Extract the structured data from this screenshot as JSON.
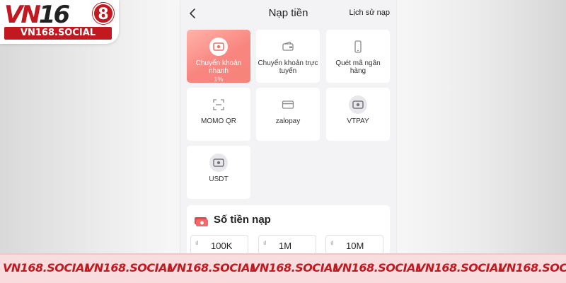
{
  "logo": {
    "main_red": "VN",
    "main_dark": "16",
    "circle": "8",
    "sub": "VN168.SOCIAL"
  },
  "header": {
    "back_icon": "chevron-left-icon",
    "title": "Nạp tiền",
    "history_label": "Lịch sử nạp"
  },
  "methods": [
    {
      "label": "Chuyển khoản nhanh",
      "sub": "1%",
      "icon": "money-transfer-icon",
      "active": true
    },
    {
      "label": "Chuyển khoản trực tuyến",
      "icon": "wallet-icon",
      "active": false
    },
    {
      "label": "Quét mã ngân hàng",
      "icon": "phone-icon",
      "active": false
    },
    {
      "label": "MOMO QR",
      "icon": "qr-scan-icon",
      "active": false
    },
    {
      "label": "zalopay",
      "icon": "card-icon",
      "active": false
    },
    {
      "label": "VTPAY",
      "icon": "money-transfer-icon",
      "active": false
    },
    {
      "label": "USDT",
      "icon": "money-transfer-icon",
      "active": false
    }
  ],
  "amount": {
    "icon": "cash-stack-icon",
    "title": "Số tiền nạp",
    "currency_symbol": "₫",
    "options": [
      "100K",
      "1M",
      "10M"
    ]
  },
  "banner": {
    "text": "VN168.SOCIAL",
    "repeat": 7
  },
  "colors": {
    "brand_red": "#c2181f",
    "active_tile": "#f8857f",
    "banner_bg": "#f9dcdd"
  }
}
